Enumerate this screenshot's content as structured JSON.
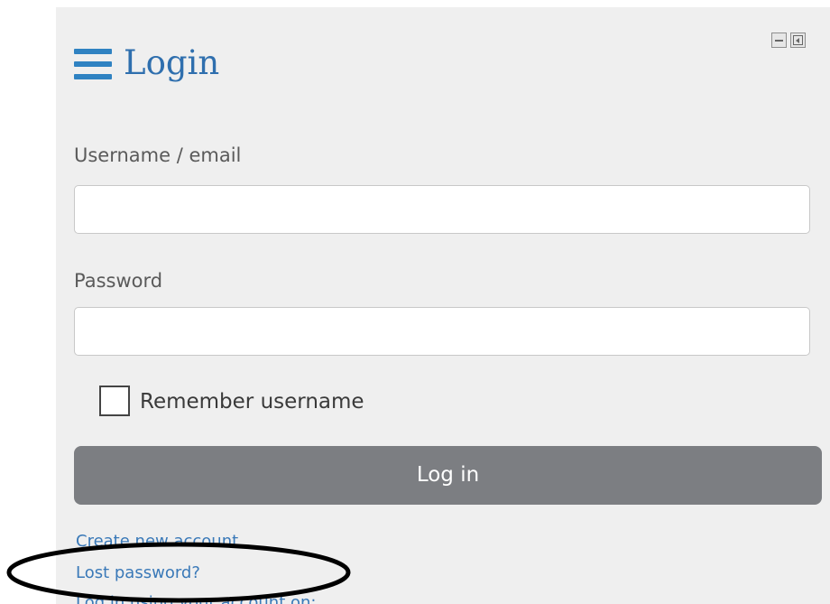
{
  "block": {
    "title": "Login",
    "controls": {
      "minimize_icon": "minus-box-icon",
      "dock_icon": "dock-box-icon"
    }
  },
  "form": {
    "username_label": "Username / email",
    "username_value": "",
    "password_label": "Password",
    "password_value": "",
    "remember_label": "Remember username",
    "remember_checked": false,
    "login_button": "Log in"
  },
  "links": {
    "create_account": "Create new account",
    "lost_password": "Lost password?",
    "oauth_login": "Log in using your account on:"
  },
  "colors": {
    "accent": "#2f82c2",
    "link": "#3a79b8",
    "button": "#7c7e82",
    "panel": "#efefef"
  }
}
